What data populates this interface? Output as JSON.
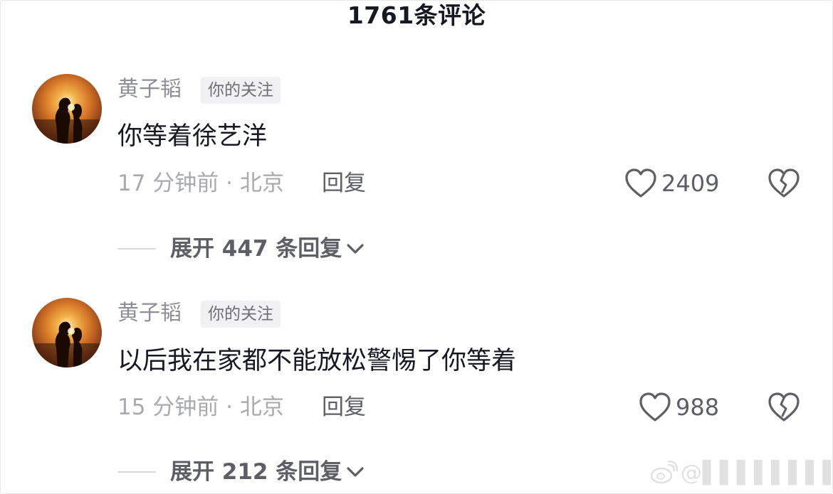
{
  "header": {
    "title": "1761条评论"
  },
  "comments": [
    {
      "author": "黄子韬",
      "badge": "你的关注",
      "text": "你等着徐艺洋",
      "time_location": "17 分钟前 · 北京",
      "reply_label": "回复",
      "likes": "2409",
      "expand_label": "展开 447 条回复"
    },
    {
      "author": "黄子韬",
      "badge": "你的关注",
      "text": "以后我在家都不能放松警惕了你等着",
      "time_location": "15 分钟前 · 北京",
      "reply_label": "回复",
      "likes": "988",
      "expand_label": "展开 212 条回复"
    }
  ],
  "colors": {
    "text": "#161823",
    "secondary": "#8e8f96",
    "icon": "#5d5e66",
    "badge_bg": "#f1f1f3"
  },
  "icons": {
    "like": "heart-outline-icon",
    "dislike": "broken-heart-icon",
    "expand": "chevron-down-icon",
    "watermark": "weibo-icon"
  },
  "watermark": {
    "handle": "@▌▌▌▌▌▌▌▌▌"
  }
}
